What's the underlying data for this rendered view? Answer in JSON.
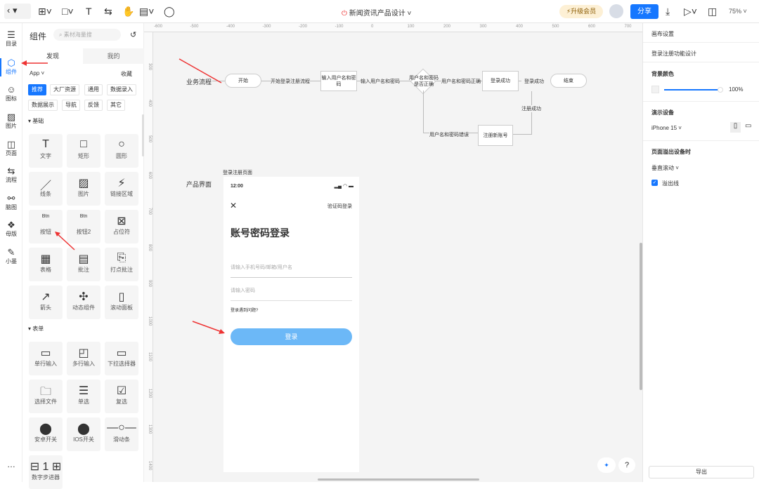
{
  "topbar": {
    "title": "新闻资讯产品设计",
    "upgrade": "升级会员",
    "share": "分享",
    "zoom": "75%"
  },
  "iconbar": [
    {
      "icon": "☰",
      "label": "目录"
    },
    {
      "icon": "⬡",
      "label": "组件"
    },
    {
      "icon": "☺",
      "label": "图标"
    },
    {
      "icon": "▨",
      "label": "图片"
    },
    {
      "icon": "◫",
      "label": "页面"
    },
    {
      "icon": "⇆",
      "label": "流程"
    },
    {
      "icon": "⚯",
      "label": "脑图"
    },
    {
      "icon": "❖",
      "label": "母版"
    },
    {
      "icon": "✎",
      "label": "小墨"
    }
  ],
  "panel": {
    "title": "组件",
    "search_placeholder": "素材海量搜",
    "tabs": [
      "发现",
      "我的"
    ],
    "platform": "App",
    "favorites": "收藏",
    "tags": [
      "推荐",
      "大厂资源",
      "通用",
      "数据录入",
      "数据展示",
      "导航",
      "反馈",
      "其它"
    ],
    "sections": [
      {
        "name": "基础",
        "items": [
          {
            "i": "T",
            "l": "文字"
          },
          {
            "i": "□",
            "l": "矩形"
          },
          {
            "i": "○",
            "l": "圆形"
          },
          {
            "i": "／",
            "l": "线条"
          },
          {
            "i": "▨",
            "l": "图片"
          },
          {
            "i": "⚡",
            "l": "链接区域"
          },
          {
            "i": "Btn",
            "l": "按钮"
          },
          {
            "i": "Btn",
            "l": "按钮2"
          },
          {
            "i": "⊠",
            "l": "占位符"
          },
          {
            "i": "▦",
            "l": "表格"
          },
          {
            "i": "▤",
            "l": "批注"
          },
          {
            "i": "⎘",
            "l": "打点批注"
          },
          {
            "i": "↗",
            "l": "箭头"
          },
          {
            "i": "✣",
            "l": "动态组件"
          },
          {
            "i": "▯",
            "l": "滚动面板"
          }
        ]
      },
      {
        "name": "表单",
        "items": [
          {
            "i": "▭",
            "l": "单行输入"
          },
          {
            "i": "◰",
            "l": "多行输入"
          },
          {
            "i": "▭",
            "l": "下拉选择器"
          },
          {
            "i": "🗀",
            "l": "选择文件"
          },
          {
            "i": "☰",
            "l": "单选"
          },
          {
            "i": "☑",
            "l": "复选"
          },
          {
            "i": "⬤",
            "l": "安卓开关"
          },
          {
            "i": "⬤",
            "l": "IOS开关"
          },
          {
            "i": "—○—",
            "l": "滑动条"
          },
          {
            "i": "⊟ 1 ⊞",
            "l": "数字步进器"
          }
        ]
      }
    ]
  },
  "rulers": {
    "top": [
      "-600",
      "-500",
      "-400",
      "-300",
      "-200",
      "-100",
      "0",
      "100",
      "200",
      "300",
      "400",
      "500",
      "600",
      "700"
    ],
    "left": [
      "300",
      "400",
      "500",
      "600",
      "700",
      "800",
      "900",
      "1000",
      "1100",
      "1200",
      "1300",
      "1400"
    ]
  },
  "flow": {
    "title": "业务流程",
    "start": "开始",
    "e1": "开始登录注册流程",
    "n1": "输入用户名和密码",
    "e2": "输入用户名和密码",
    "d": "用户名和密码是否正确",
    "e3": "用户名和密码正确",
    "n2": "登录成功",
    "e4": "登录成功",
    "end": "结束",
    "e5": "用户名和密码错误",
    "n3": "注册新账号",
    "e6": "注册成功"
  },
  "product": {
    "title": "产品界面",
    "page_label": "登录注册页面",
    "time": "12:00",
    "code_login": "验证码登录",
    "heading": "账号密码登录",
    "user_placeholder": "请输入手机号码/邮箱/用户名",
    "pwd_placeholder": "请输入密码",
    "problem": "登录遇到问题?",
    "login": "登录"
  },
  "right": {
    "canvas_settings": "画布设置",
    "page_name": "登录注册功能设计",
    "bg_title": "背景颜色",
    "bg_opacity": "100%",
    "device_title": "演示设备",
    "device": "iPhone 15",
    "overflow_title": "页面溢出设备时",
    "overflow_mode": "垂直滚动",
    "overflow_line": "溢出线",
    "export": "导出"
  },
  "colors": {
    "accent": "#1677ff",
    "login_btn": "#6cb8f7"
  }
}
